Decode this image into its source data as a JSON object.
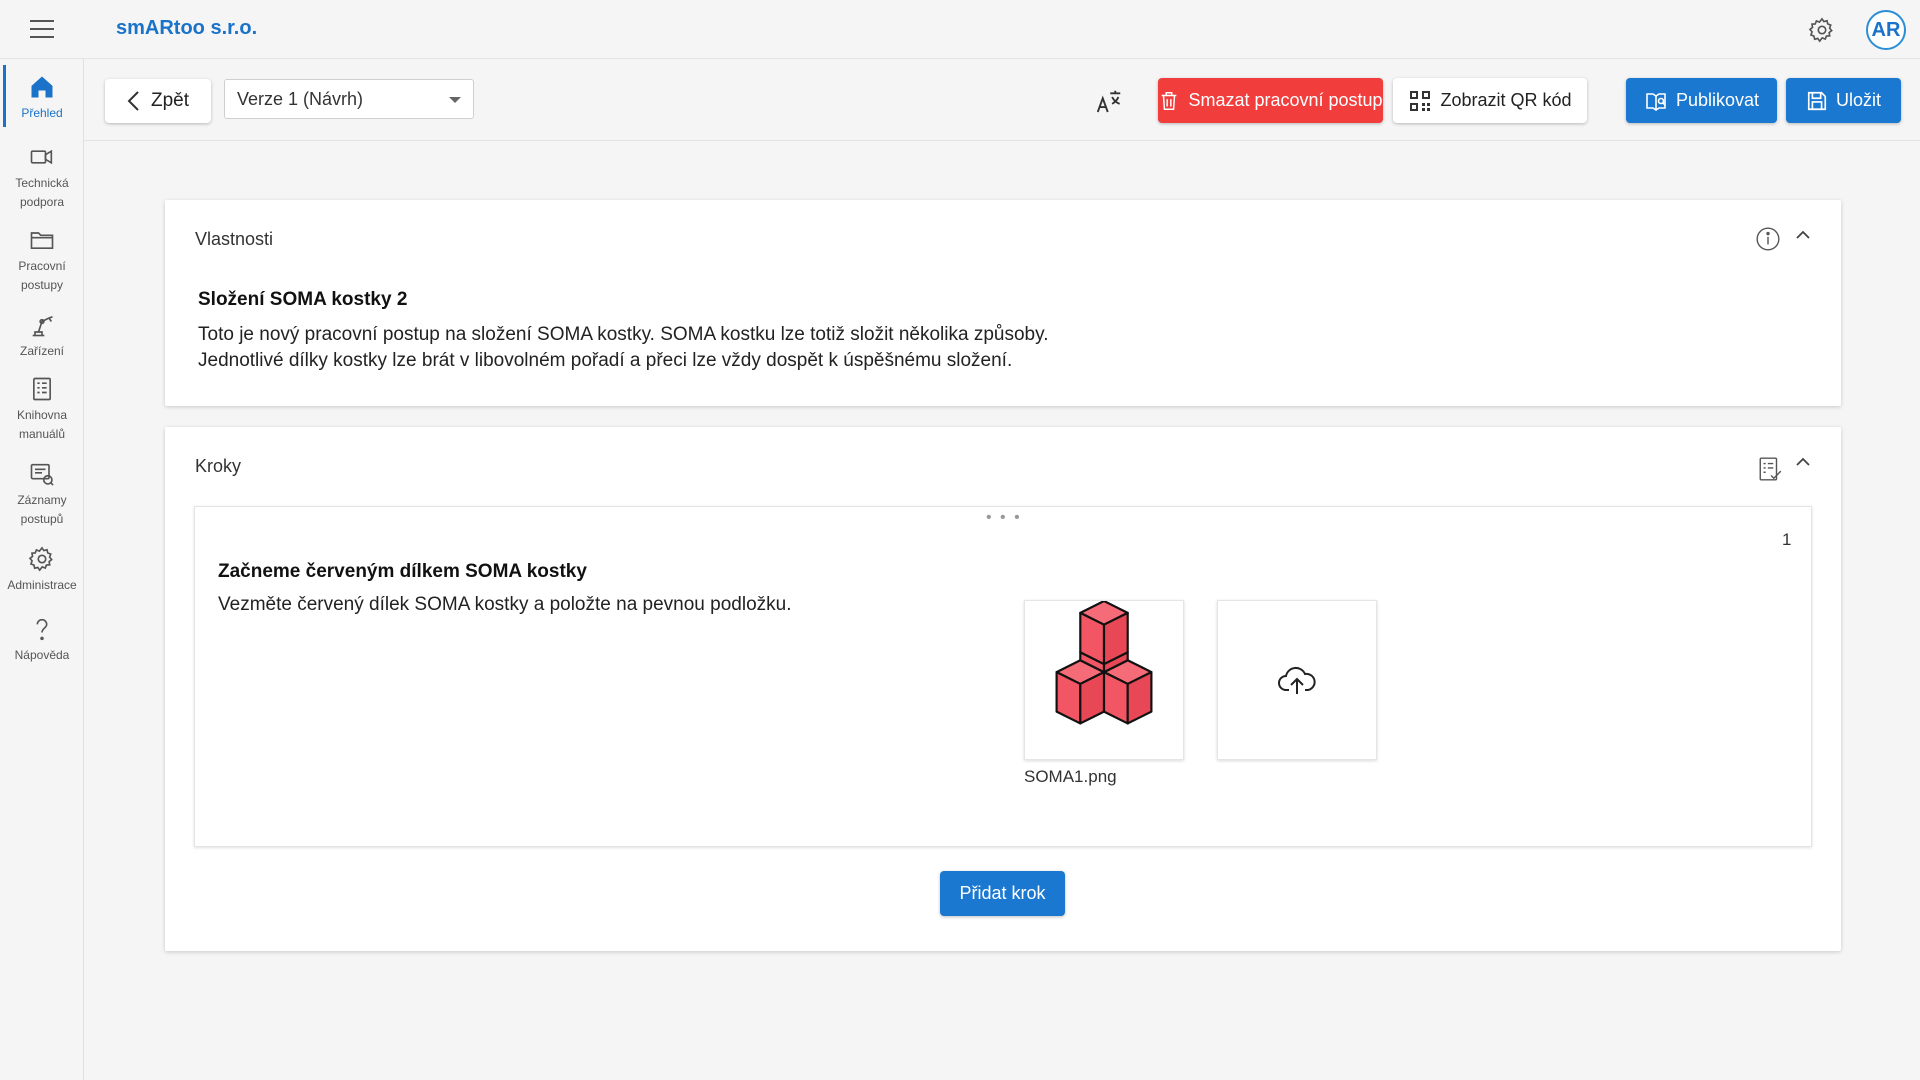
{
  "appbar": {
    "brand": "smARtoo s.r.o.",
    "avatar_initials": "AR",
    "icons": [
      "menu-icon",
      "gear-icon"
    ]
  },
  "sidebar": {
    "items": [
      {
        "label": "Přehled",
        "icon": "home-icon",
        "active": true
      },
      {
        "label": "Technická\npodpora",
        "icon": "video-camera-icon"
      },
      {
        "label": "Pracovní\npostupy",
        "icon": "folder-icon"
      },
      {
        "label": "Zařízení",
        "icon": "robot-arm-icon"
      },
      {
        "label": "Knihovna\nmanuálů",
        "icon": "manual-icon"
      },
      {
        "label": "Záznamy\npostupů",
        "icon": "records-icon"
      },
      {
        "label": "Administrace",
        "icon": "gear-icon"
      },
      {
        "label": "Nápověda",
        "icon": "question-icon"
      }
    ]
  },
  "toolbar": {
    "back_label": "Zpět",
    "version_select": "Verze 1 (Návrh)",
    "delete_label": "Smazat pracovní postup",
    "qr_label": "Zobrazit QR kód",
    "publish_label": "Publikovat",
    "save_label": "Uložit"
  },
  "properties": {
    "heading": "Vlastnosti",
    "title": "Složení SOMA kostky 2",
    "description_line1": "Toto je nový pracovní postup na složení SOMA kostky. SOMA kostku lze totiž složit několika způsoby.",
    "description_line2": "Jednotlivé dílky kostky lze brát v libovolném pořadí a přeci lze vždy dospět k úspěšnému složení."
  },
  "steps": {
    "heading": "Kroky",
    "items": [
      {
        "number": "1",
        "title": "Začneme červeným dílkem SOMA kostky",
        "description": "Vezměte červený dílek SOMA kostky a položte na pevnou podložku.",
        "image_name": "SOMA1.png"
      }
    ],
    "add_label": "Přidat krok"
  },
  "colors": {
    "accent": "#1b78d0",
    "danger": "#f23d3d",
    "cube": "#f25563"
  }
}
